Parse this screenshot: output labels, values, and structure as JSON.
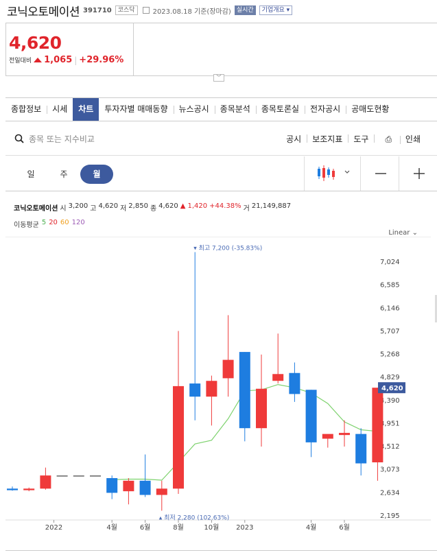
{
  "header": {
    "name": "코닉오토메이션",
    "code": "391710",
    "market": "코스닥",
    "date": "2023.08.18 기준(장마감)",
    "realtime": "실시간",
    "overview": "기업개요"
  },
  "price": {
    "current": "4,620",
    "change_label": "전일대비",
    "change": "1,065",
    "change_pct": "+29.96%"
  },
  "tabs": [
    "종합정보",
    "시세",
    "차트",
    "투자자별 매매동향",
    "뉴스공시",
    "종목분석",
    "종목토론실",
    "전자공시",
    "공매도현황"
  ],
  "active_tab": "차트",
  "search": {
    "placeholder": "종목 또는 지수비교"
  },
  "tools": [
    "공시",
    "보조지표",
    "도구",
    "인쇄"
  ],
  "periods": [
    "일",
    "주",
    "월"
  ],
  "active_period": "월",
  "info": {
    "name": "코닉오토메이션",
    "open_label": "시",
    "open": "3,200",
    "high_label": "고",
    "high": "4,620",
    "low_label": "저",
    "low": "2,850",
    "close_label": "종",
    "close": "4,620",
    "change": "1,420",
    "change_pct": "+44.38%",
    "volume_label": "거",
    "volume": "21,149,887"
  },
  "ma": {
    "label": "이동평균",
    "periods": [
      "5",
      "20",
      "60",
      "120"
    ],
    "colors": [
      "#4caf50",
      "#e0242b",
      "#f0a020",
      "#9c5bb5"
    ]
  },
  "scale_label": "Linear",
  "colors": {
    "up": "#ef3a3a",
    "down": "#1e7de0",
    "accent": "#3d5a9e",
    "ma5": "#7ed26e"
  },
  "chart_data": {
    "type": "candlestick",
    "x_tick_labels": [
      "2022",
      "4월",
      "6월",
      "8월",
      "10월",
      "2023",
      "4월",
      "6월"
    ],
    "y_ticks": [
      2195,
      2634,
      3073,
      3512,
      3951,
      4390,
      4829,
      5268,
      5707,
      6146,
      6585,
      7024
    ],
    "y_tick_labels": [
      "2,195",
      "2,634",
      "3,073",
      "3,512",
      "3,951",
      "4,390",
      "4,829",
      "5,268",
      "5,707",
      "6,146",
      "6,585",
      "7,024"
    ],
    "ylim": [
      1950,
      7250
    ],
    "last_price_label": "4,620",
    "high_annotation": "최고 7,200 (-35.83%)",
    "low_annotation": "최저 2,280 (102.63%)",
    "candles": [
      {
        "o": 2700,
        "h": 2740,
        "c": 2670,
        "l": 2660
      },
      {
        "o": 2670,
        "h": 2720,
        "c": 2700,
        "l": 2650
      },
      {
        "o": 2700,
        "h": 3100,
        "c": 2950,
        "l": 2680
      },
      {
        "o": 2940,
        "h": 2940,
        "c": 2940,
        "l": 2940
      },
      {
        "o": 2940,
        "h": 2940,
        "c": 2940,
        "l": 2940
      },
      {
        "o": 2940,
        "h": 2940,
        "c": 2940,
        "l": 2940
      },
      {
        "o": 2900,
        "h": 2950,
        "c": 2620,
        "l": 2500
      },
      {
        "o": 2650,
        "h": 2900,
        "c": 2850,
        "l": 2400
      },
      {
        "o": 2850,
        "h": 3350,
        "c": 2580,
        "l": 2540
      },
      {
        "o": 2580,
        "h": 2850,
        "c": 2700,
        "l": 2280
      },
      {
        "o": 2700,
        "h": 5700,
        "c": 4650,
        "l": 2600
      },
      {
        "o": 4700,
        "h": 7200,
        "c": 4450,
        "l": 4000
      },
      {
        "o": 4450,
        "h": 4850,
        "c": 4750,
        "l": 3900
      },
      {
        "o": 4800,
        "h": 6000,
        "c": 5150,
        "l": 4450
      },
      {
        "o": 5300,
        "h": 5300,
        "c": 3850,
        "l": 3600
      },
      {
        "o": 3850,
        "h": 5250,
        "c": 4600,
        "l": 3500
      },
      {
        "o": 4750,
        "h": 5650,
        "c": 4880,
        "l": 4700
      },
      {
        "o": 4900,
        "h": 5100,
        "c": 4500,
        "l": 4350
      },
      {
        "o": 4580,
        "h": 4580,
        "c": 3580,
        "l": 3300
      },
      {
        "o": 3650,
        "h": 3700,
        "c": 3740,
        "l": 3480
      },
      {
        "o": 3720,
        "h": 4000,
        "c": 3760,
        "l": 3500
      },
      {
        "o": 3740,
        "h": 3850,
        "c": 3180,
        "l": 2950
      },
      {
        "o": 3200,
        "h": 4620,
        "c": 4620,
        "l": 2850
      }
    ],
    "ma5": [
      null,
      null,
      null,
      null,
      null,
      null,
      2870,
      2880,
      2880,
      2860,
      3200,
      3550,
      3620,
      4030,
      4560,
      4580,
      4680,
      4620,
      4520,
      4320,
      3970,
      3820,
      3790
    ]
  }
}
